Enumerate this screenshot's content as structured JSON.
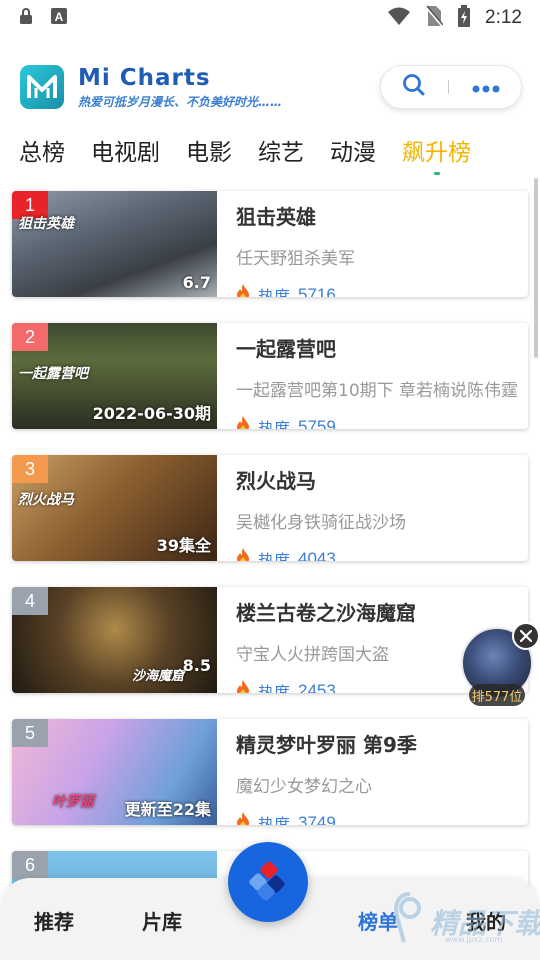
{
  "status_bar": {
    "time": "2:12",
    "icons": [
      "lock-icon",
      "a-icon",
      "wifi-icon",
      "no-sim-icon",
      "battery-icon"
    ]
  },
  "header": {
    "app_name": "Mi Charts",
    "slogan": "热爱可抵岁月漫长、不负美好时光……",
    "logo_icon": "m-logo-icon",
    "actions": [
      "search-icon",
      "more-icon"
    ]
  },
  "tabs": [
    {
      "label": "总榜"
    },
    {
      "label": "电视剧"
    },
    {
      "label": "电影"
    },
    {
      "label": "综艺"
    },
    {
      "label": "动漫"
    },
    {
      "label": "飙升榜",
      "active": true
    }
  ],
  "colors": {
    "accent": "#f5b400",
    "heat_blue": "#3a7ed6",
    "rank1": "#e8232a",
    "rank2": "#f26a6a",
    "rank3": "#f39a4e",
    "rank_other": "#9aa3ad"
  },
  "items": [
    {
      "rank": "1",
      "title": "狙击英雄",
      "subtitle": "任天野狙杀美军",
      "heat_label": "热度",
      "heat": "5716",
      "poster_tag": "6.7",
      "poster_title": "狙击英雄"
    },
    {
      "rank": "2",
      "title": "一起露营吧",
      "subtitle": "一起露营吧第10期下 章若楠说陈伟霆",
      "heat_label": "热度",
      "heat": "5759",
      "poster_tag": "2022-06-30期",
      "poster_title": "一起露营吧"
    },
    {
      "rank": "3",
      "title": "烈火战马",
      "subtitle": "吴樾化身铁骑征战沙场",
      "heat_label": "热度",
      "heat": "4043",
      "poster_tag": "39集全",
      "poster_title": "烈火战马"
    },
    {
      "rank": "4",
      "title": "楼兰古卷之沙海魔窟",
      "subtitle": "守宝人火拼跨国大盗",
      "heat_label": "热度",
      "heat": "2453",
      "poster_tag": "8.5",
      "poster_title": "沙海魔窟"
    },
    {
      "rank": "5",
      "title": "精灵梦叶罗丽 第9季",
      "subtitle": "魔幻少女梦幻之心",
      "heat_label": "热度",
      "heat": "3749",
      "poster_tag": "更新至22集",
      "poster_title": "叶罗丽"
    },
    {
      "rank": "6",
      "title": "",
      "subtitle": "",
      "heat_label": "",
      "heat": "",
      "poster_tag": "",
      "poster_title": ""
    }
  ],
  "float_widget": {
    "rank_text": "排577位"
  },
  "bottom_nav": {
    "items": [
      {
        "label": "推荐"
      },
      {
        "label": "片库"
      },
      {
        "label": "榜单",
        "active": true
      },
      {
        "label": "我的"
      }
    ]
  },
  "watermark": {
    "text": "精品下载",
    "url": "www.jpxz.com"
  }
}
